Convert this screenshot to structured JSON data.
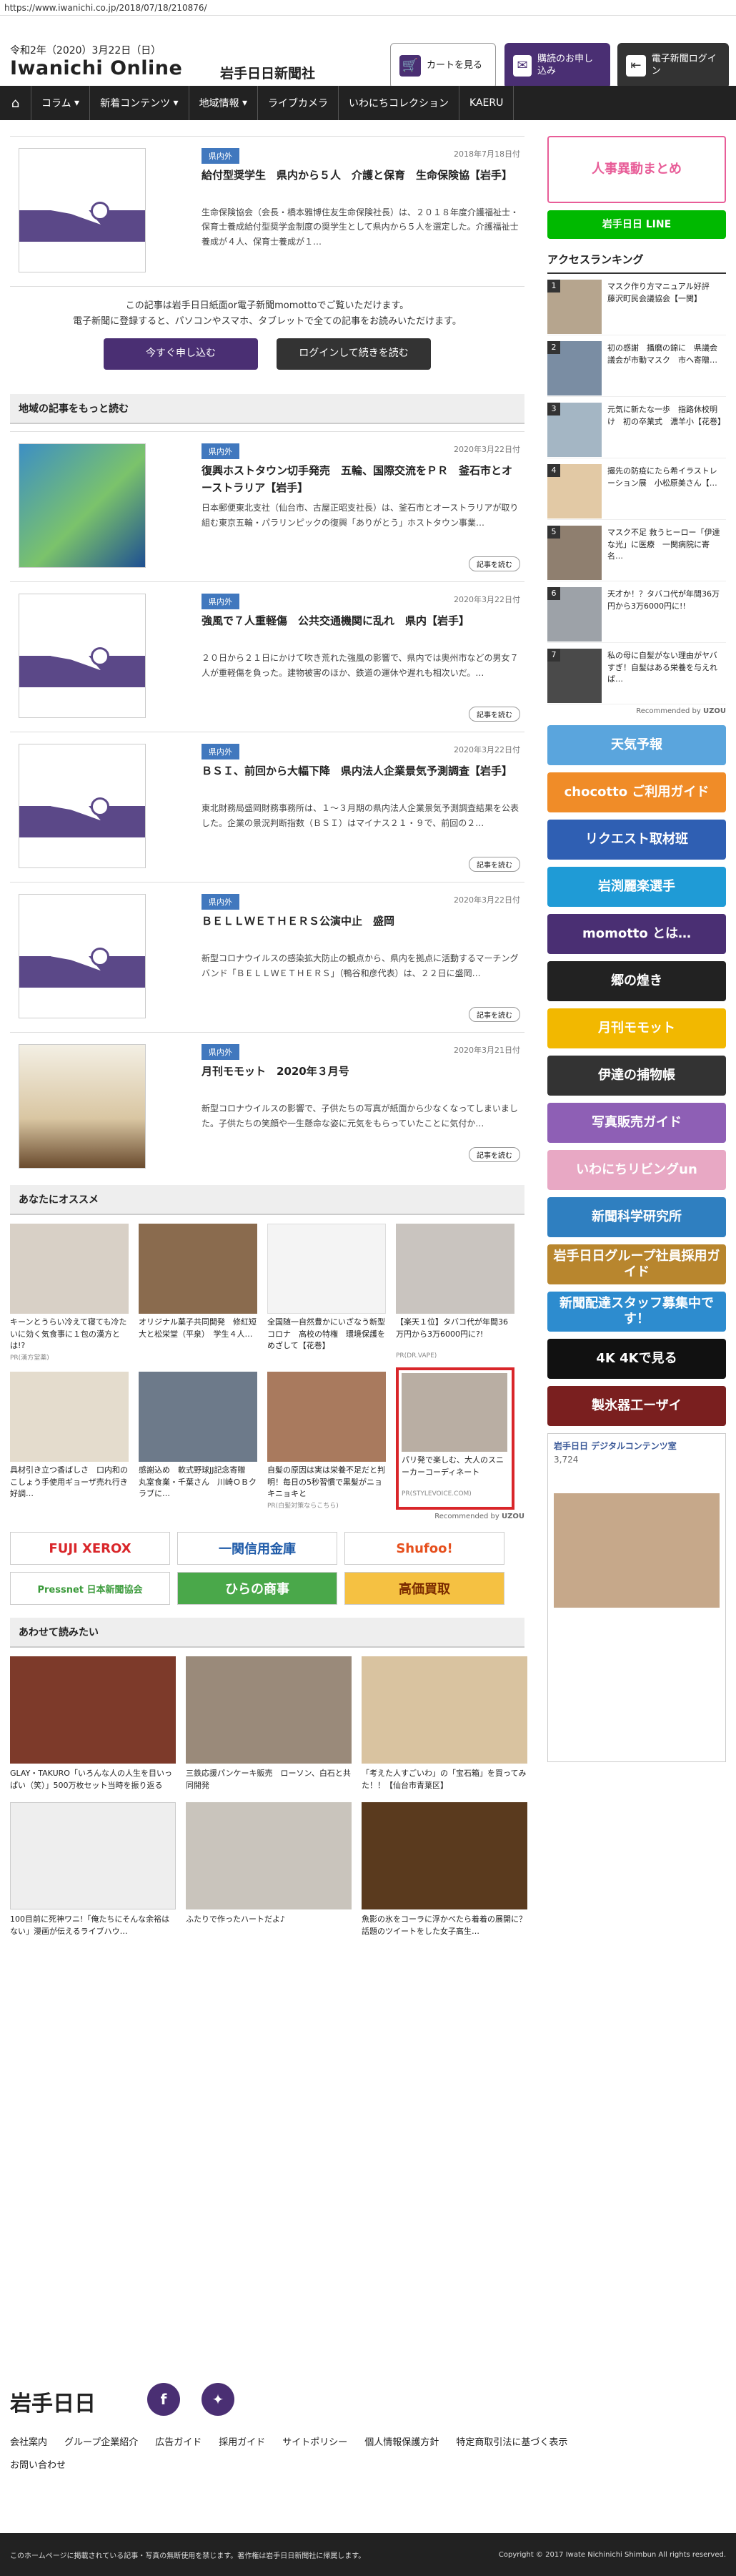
{
  "browser": {
    "url": "https://www.iwanichi.co.jp/2018/07/18/210876/"
  },
  "header": {
    "date": "令和2年（2020）3月22日（日）",
    "logo": "Iwanichi Online",
    "logo_sub": "岩手日日新聞社",
    "cart_label": "カートを見る",
    "apply_label": "購読のお申し込み",
    "login_label": "電子新聞ログイン"
  },
  "nav": [
    "コラム",
    "新着コンテンツ",
    "地域情報",
    "ライブカメラ",
    "いわにちコレクション",
    "KAERU"
  ],
  "featured": {
    "tag": "県内外",
    "date": "2018年7月18日付",
    "title": "給付型奨学生　県内から５人　介護と保育　生命保険協【岩手】",
    "body": "生命保険協会（会長・橋本雅博住友生命保険社長）は、２０１８年度介護福祉士・保育士養成給付型奨学金制度の奨学生として県内から５人を選定した。介護福祉士養成が４人、保育士養成が１…"
  },
  "paywall": {
    "line1": "この記事は岩手日日紙面or電子新聞momottoでご覧いただけます。",
    "line2": "電子新聞に登録すると、パソコンやスマホ、タブレットで全ての記事をお読みいただけます。",
    "apply_btn": "今すぐ申し込む",
    "login_btn": "ログインして続きを読む"
  },
  "local_heading": "地域の記事をもっと読む",
  "local_articles": [
    {
      "tag": "県内外",
      "date": "2020年3月22日付",
      "title": "復興ホストタウン切手発売　五輪、国際交流をＰＲ　釜石市とオーストラリア【岩手】",
      "body": "日本郵便東北支社（仙台市、古屋正昭支社長）は、釜石市とオーストラリアが取り組む東京五輪・パラリンピックの復興「ありがとう」ホストタウン事業…",
      "more": "記事を読む"
    },
    {
      "tag": "県内外",
      "date": "2020年3月22日付",
      "title": "強風で７人重軽傷　公共交通機関に乱れ　県内【岩手】",
      "body": "２０日から２１日にかけて吹き荒れた強風の影響で、県内では奥州市などの男女７人が重軽傷を負った。建物被害のほか、鉄道の運休や遅れも相次いだ。…",
      "more": "記事を読む"
    },
    {
      "tag": "県内外",
      "date": "2020年3月22日付",
      "title": "ＢＳＩ、前回から大幅下降　県内法人企業景気予測調査【岩手】",
      "body": "東北財務局盛岡財務事務所は、１～３月期の県内法人企業景気予測調査結果を公表した。企業の景況判断指数（ＢＳＩ）はマイナス２１・９で、前回の２…",
      "more": "記事を読む"
    },
    {
      "tag": "県内外",
      "date": "2020年3月22日付",
      "title": "ＢＥＬＬＷＥＴＨＥＲＳ公演中止　盛岡",
      "body": "新型コロナウイルスの感染拡大防止の観点から、県内を拠点に活動するマーチングバンド「ＢＥＬＬＷＥＴＨＥＲＳ」（鴨谷和彦代表）は、２２日に盛岡…",
      "more": "記事を読む"
    },
    {
      "tag": "県内外",
      "date": "2020年3月21日付",
      "title": "月刊モモット　2020年３月号",
      "body": "新型コロナウイルスの影響で、子供たちの写真が紙面から少なくなってしまいました。子供たちの笑顔や一生懸命な姿に元気をもらっていたことに気付か…",
      "more": "記事を読む"
    }
  ],
  "recommend_heading": "あなたにオススメ",
  "recommend": [
    {
      "text": "キーンとうらい冷えて寝ても冷たいに効く気食事に１包の漢方とは!?",
      "src": "PR(漢方堂薬)"
    },
    {
      "text": "オリジナル菓子共同開発　修紅短大と松栄堂（平泉）　学生４人…",
      "src": ""
    },
    {
      "text": "全国随一自然豊かにいざなう新型コロナ　高校の特権　環境保護をめざして【花巻】",
      "src": ""
    },
    {
      "text": "【楽天１位】タバコ代が年間36万円から3万6000円に?!",
      "src": "PR(DR.VAPE)"
    },
    {
      "text": "具材引き立つ香ばしさ　口内和のこしょう手使用ギョーザ売れ行き好調…",
      "src": ""
    },
    {
      "text": "感謝込め　軟式野球JJ記念寄贈　丸室食業・千葉さん　川崎ＯＢクラブに…",
      "src": ""
    },
    {
      "text": "自髪の原因は実は栄養不足だと判明！毎日の5秒習慣で黒髪がニョキニョキと",
      "src": "PR(白髪対策ならこちら)"
    },
    {
      "text": "パリ発で楽しむ、大人のスニーカーコーディネート",
      "src": "PR(STYLEVOICE.COM)"
    }
  ],
  "recommended_by": "Recommended by",
  "ads": [
    "FUJI XEROX",
    "一関信用金庫",
    "Shufoo!",
    "Pressnet 日本新聞協会",
    "ひらの商事",
    "高価買取"
  ],
  "also_heading": "あわせて読みたい",
  "also_read": [
    {
      "text": "GLAY・TAKURO「いろんな人の人生を目いっぱい（笑）」500万枚セット当時を振り返る"
    },
    {
      "text": "三鉄応援パンケーキ販売　ローソン、白石と共同開発"
    },
    {
      "text": "「考えた人すごいわ」の「宝石箱」を買ってみた！！【仙台市青葉区】"
    },
    {
      "text": "100目前に死神ワニ!「俺たちにそんな余裕はない」漫画が伝えるライブハウ…"
    },
    {
      "text": "ふたりで作ったハートだよ♪"
    },
    {
      "text": "魚影の氷をコーラに浮かべたら着着の展開に？話題のツイートをした女子高生…"
    }
  ],
  "sidebar": {
    "banners": [
      {
        "text": "人事異動まとめ",
        "color": "#e85d98"
      },
      {
        "text": "岩手日日 LINE",
        "color": "#00b900"
      }
    ],
    "ranking_heading": "アクセスランキング",
    "ranking": [
      {
        "num": "1",
        "text": "マスク作り方マニュアル好評　藤沢町民会議協会【一関】"
      },
      {
        "num": "2",
        "text": "初の感謝　播磨の錦に　県議会議会が市動マスク　市へ寄贈…"
      },
      {
        "num": "3",
        "text": "元気に新たな一歩　指路休校明け　初の卒業式　濃羊小【花巻】"
      },
      {
        "num": "4",
        "text": "撮先の防疫にたら希イラストレーション展　小松原美さん【…"
      },
      {
        "num": "5",
        "text": "マスク不足 救うヒーロー「伊達な光」に医療　一関病院に寄名…"
      },
      {
        "num": "6",
        "text": "天才か！？タバコ代が年間36万円から3万6000円に!!"
      },
      {
        "num": "7",
        "text": "私の母に自髪がない理由がヤバすぎ！自髪はある栄養を与えれば…"
      }
    ],
    "tiles": [
      {
        "text": "天気予報",
        "color": "#5aa5dd"
      },
      {
        "text": "chocotto ご利用ガイド",
        "color": "#f08c28"
      },
      {
        "text": "リクエスト取材班",
        "color": "#2f5fb3"
      },
      {
        "text": "岩渕麗楽選手",
        "color": "#1f9bd6"
      },
      {
        "text": "momotto とは…",
        "color": "#4a2f73"
      },
      {
        "text": "郷の煌き",
        "color": "#222222"
      },
      {
        "text": "月刊モモット",
        "color": "#f2b800"
      },
      {
        "text": "伊達の捕物帳",
        "color": "#333333"
      },
      {
        "text": "写真販売ガイド",
        "color": "#8e5fb5"
      },
      {
        "text": "いわにちリビングun",
        "color": "#e8a8c4"
      },
      {
        "text": "新聞科学研究所",
        "color": "#2f7fc0"
      },
      {
        "text": "岩手日日グループ社員採用ガイド",
        "color": "#b8862e"
      },
      {
        "text": "新聞配達スタッフ募集中です！",
        "color": "#2d8ccf"
      },
      {
        "text": "4K 4Kで見る",
        "color": "#111111"
      },
      {
        "text": "製氷器工ーザイ",
        "color": "#7a1f1f"
      }
    ],
    "fb_page": "岩手日日 デジタルコンテンツ室",
    "fb_likes": "3,724"
  },
  "footer": {
    "logo": "岩手日日",
    "links": [
      "会社案内",
      "グループ企業紹介",
      "広告ガイド",
      "採用ガイド",
      "サイトポリシー",
      "個人情報保護方針",
      "特定商取引法に基づく表示"
    ],
    "link2": "お問い合わせ",
    "notice": "このホームページに掲載されている記事・写真の無断使用を禁じます。著作権は岩手日日新聞社に帰属します。",
    "copyright": "Copyright © 2017 Iwate Nichinichi Shimbun All rights reserved."
  }
}
